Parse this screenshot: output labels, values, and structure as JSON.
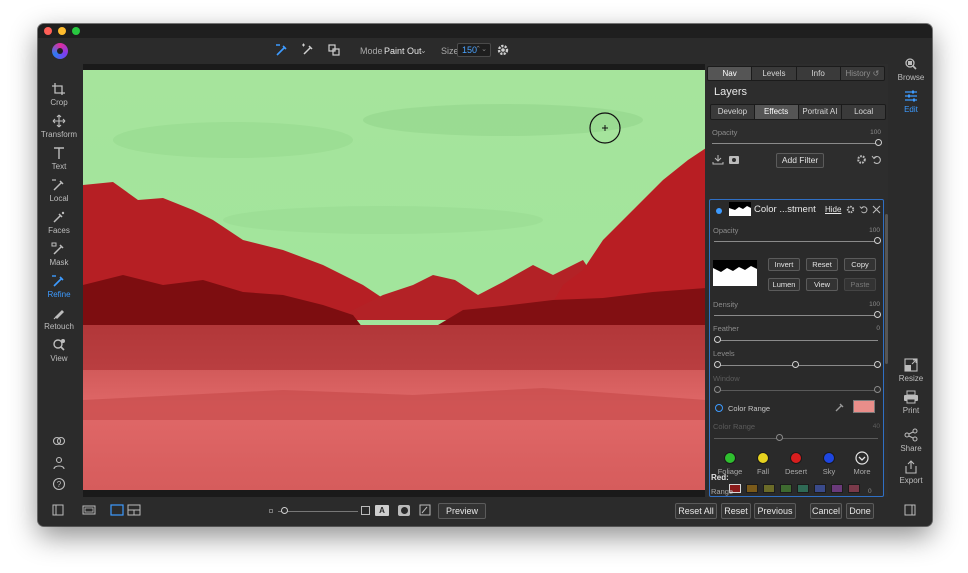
{
  "toolbar": {
    "mode_label": "Mode",
    "mode_value": "Paint Out",
    "size_label": "Size",
    "size_value": "150"
  },
  "left_tools": [
    {
      "label": "Crop",
      "icon": "crop-icon"
    },
    {
      "label": "Transform",
      "icon": "transform-icon"
    },
    {
      "label": "Text",
      "icon": "text-icon"
    },
    {
      "label": "Local",
      "icon": "local-brush-icon"
    },
    {
      "label": "Faces",
      "icon": "faces-icon"
    },
    {
      "label": "Mask",
      "icon": "mask-brush-icon"
    },
    {
      "label": "Refine",
      "icon": "refine-brush-icon",
      "active": true
    },
    {
      "label": "Retouch",
      "icon": "retouch-icon"
    },
    {
      "label": "View",
      "icon": "view-zoom-icon"
    }
  ],
  "right_modules": [
    {
      "label": "Browse",
      "icon": "browse-icon"
    },
    {
      "label": "Edit",
      "icon": "edit-sliders-icon",
      "active": true
    },
    {
      "label": "Resize",
      "icon": "resize-icon"
    },
    {
      "label": "Print",
      "icon": "print-icon"
    },
    {
      "label": "Share",
      "icon": "share-icon"
    },
    {
      "label": "Export",
      "icon": "export-icon"
    }
  ],
  "panel": {
    "top_tabs": [
      "Nav",
      "Levels",
      "Info",
      "History"
    ],
    "title": "Layers",
    "layer_tabs": [
      "Develop",
      "Effects",
      "Portrait AI",
      "Local"
    ],
    "opacity_label": "Opacity",
    "opacity_value": "100",
    "add_filter": "Add Filter",
    "filter": {
      "name": "Color ...stment",
      "hide": "Hide",
      "opacity_label": "Opacity",
      "opacity_value": "100",
      "buttons": [
        "Invert",
        "Reset",
        "Copy",
        "Lumen",
        "View",
        "Paste"
      ],
      "density_label": "Density",
      "density_value": "100",
      "feather_label": "Feather",
      "feather_value": "0",
      "levels_label": "Levels",
      "window_label": "Window",
      "color_range_label": "Color Range",
      "color_range_slider_label": "Color Range",
      "color_range_value": "40",
      "color_range_fill": 0.6,
      "colors": [
        {
          "name": "Foliage",
          "hex": "#2fbf2f"
        },
        {
          "name": "Fall",
          "hex": "#e6d21f"
        },
        {
          "name": "Desert",
          "hex": "#d81e1e"
        },
        {
          "name": "Sky",
          "hex": "#1e46e0"
        },
        {
          "name": "More",
          "hex": "#2d2d2d"
        }
      ],
      "swatches": [
        "#8a1a1a",
        "#7a5a1a",
        "#6b6b28",
        "#3e6a30",
        "#2f6a55",
        "#3a4a8a",
        "#6a3a7a",
        "#7a3a4a"
      ],
      "picked_color": "#e98e8a",
      "red_label": "Red:",
      "range_label": "Range",
      "range_value": "0"
    }
  },
  "bottom": {
    "preview": "Preview",
    "reset_all": "Reset All",
    "reset": "Reset",
    "previous": "Previous",
    "cancel": "Cancel",
    "done": "Done"
  },
  "colors": {
    "accent": "#3d9bff",
    "mask_sky": "#9fe59a",
    "mask_red": "#c8292b"
  }
}
